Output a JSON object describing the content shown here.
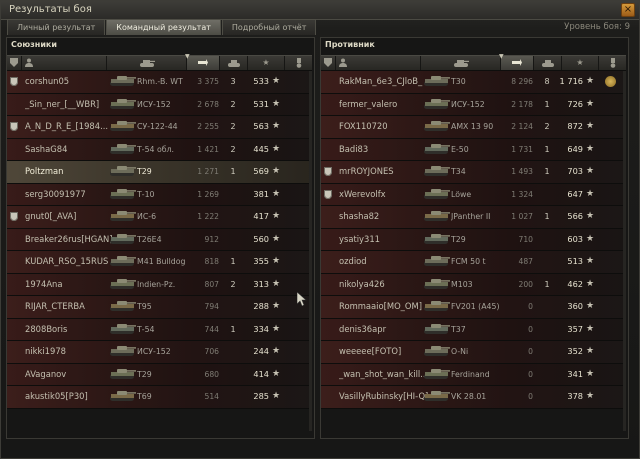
{
  "window": {
    "title": "Результаты боя",
    "close_glyph": "×"
  },
  "tabs": [
    {
      "label": "Личный результат",
      "active": false
    },
    {
      "label": "Командный результат",
      "active": true
    },
    {
      "label": "Подробный отчёт",
      "active": false
    }
  ],
  "battle_level": "Уровень боя: 9",
  "columns": {
    "platoon_icon": "platoon-icon",
    "player_icon": "player-icon",
    "vehicle_icon": "tank-icon",
    "damage_icon": "damage-icon",
    "kills_icon": "destroyed-tank-icon",
    "xp_icon": "experience-star-icon",
    "medal_icon": "achievement-icon",
    "sort_arrow": "▼"
  },
  "allies": {
    "title": "Союзники",
    "rows": [
      {
        "player": "corshun05",
        "platoon": true,
        "vehicle": "Rhm.-B. WT",
        "damage": "3 375",
        "kills": "3",
        "xp": "533"
      },
      {
        "player": "_Sin_ner_[__WBR]",
        "platoon": false,
        "vehicle": "ИСУ-152",
        "damage": "2 678",
        "kills": "2",
        "xp": "531"
      },
      {
        "player": "A_N_D_R_E_[1984...",
        "platoon": true,
        "vehicle": "СУ-122-44",
        "damage": "2 255",
        "kills": "2",
        "xp": "563"
      },
      {
        "player": "SashaG84",
        "platoon": false,
        "vehicle": "Т-54 обл.",
        "damage": "1 421",
        "kills": "2",
        "xp": "445"
      },
      {
        "player": "Poltzman",
        "platoon": false,
        "vehicle": "T29",
        "damage": "1 271",
        "kills": "1",
        "xp": "569",
        "self": true
      },
      {
        "player": "serg30091977",
        "platoon": false,
        "vehicle": "Т-10",
        "damage": "1 269",
        "kills": "",
        "xp": "381"
      },
      {
        "player": "gnut0[_AVA]",
        "platoon": true,
        "vehicle": "ИС-6",
        "damage": "1 222",
        "kills": "",
        "xp": "417"
      },
      {
        "player": "Breaker26rus[HGAN]",
        "platoon": false,
        "vehicle": "T26E4",
        "damage": "912",
        "kills": "",
        "xp": "560"
      },
      {
        "player": "KUDAR_RSO_15RUS",
        "platoon": false,
        "vehicle": "M41 Bulldog",
        "damage": "818",
        "kills": "1",
        "xp": "355"
      },
      {
        "player": "1974Ana",
        "platoon": false,
        "vehicle": "Indien-Pz.",
        "damage": "807",
        "kills": "2",
        "xp": "313"
      },
      {
        "player": "RIJAR_CTERBA",
        "platoon": false,
        "vehicle": "T95",
        "damage": "794",
        "kills": "",
        "xp": "288"
      },
      {
        "player": "2808Boris",
        "platoon": false,
        "vehicle": "Т-54",
        "damage": "744",
        "kills": "1",
        "xp": "334"
      },
      {
        "player": "nikki1978",
        "platoon": false,
        "vehicle": "ИСУ-152",
        "damage": "706",
        "kills": "",
        "xp": "244"
      },
      {
        "player": "AVaganov",
        "platoon": false,
        "vehicle": "T29",
        "damage": "680",
        "kills": "",
        "xp": "414"
      },
      {
        "player": "akustik05[P30]",
        "platoon": false,
        "vehicle": "T69",
        "damage": "514",
        "kills": "",
        "xp": "285"
      }
    ]
  },
  "enemies": {
    "title": "Противник",
    "rows": [
      {
        "player": "RakMan_6e3_CJloB_",
        "platoon": false,
        "vehicle": "T30",
        "damage": "8 296",
        "kills": "8",
        "xp": "1 716",
        "medal": true
      },
      {
        "player": "fermer_valero",
        "platoon": false,
        "vehicle": "ИСУ-152",
        "damage": "2 178",
        "kills": "1",
        "xp": "726"
      },
      {
        "player": "FOX110720",
        "platoon": false,
        "vehicle": "AMX 13 90",
        "damage": "2 124",
        "kills": "2",
        "xp": "872"
      },
      {
        "player": "Badi83",
        "platoon": false,
        "vehicle": "E-50",
        "damage": "1 731",
        "kills": "1",
        "xp": "649"
      },
      {
        "player": "mrROYJONES",
        "platoon": true,
        "vehicle": "T34",
        "damage": "1 493",
        "kills": "1",
        "xp": "703"
      },
      {
        "player": "xWerevolfx",
        "platoon": true,
        "vehicle": "Löwe",
        "damage": "1 324",
        "kills": "",
        "xp": "647"
      },
      {
        "player": "shasha82",
        "platoon": false,
        "vehicle": "JPanther II",
        "damage": "1 027",
        "kills": "1",
        "xp": "566"
      },
      {
        "player": "ysatiy311",
        "platoon": false,
        "vehicle": "T29",
        "damage": "710",
        "kills": "",
        "xp": "603"
      },
      {
        "player": "ozdiod",
        "platoon": false,
        "vehicle": "FCM 50 t",
        "damage": "487",
        "kills": "",
        "xp": "513"
      },
      {
        "player": "nikolya426",
        "platoon": false,
        "vehicle": "M103",
        "damage": "200",
        "kills": "1",
        "xp": "462"
      },
      {
        "player": "Rommaaio[MO_OM]",
        "platoon": false,
        "vehicle": "FV201 (A45)",
        "damage": "0",
        "kills": "",
        "xp": "360"
      },
      {
        "player": "denis36apr",
        "platoon": false,
        "vehicle": "T37",
        "damage": "0",
        "kills": "",
        "xp": "357"
      },
      {
        "player": "weeeee[FOTO]",
        "platoon": false,
        "vehicle": "O-Ni",
        "damage": "0",
        "kills": "",
        "xp": "352"
      },
      {
        "player": "_wan_shot_wan_kill...",
        "platoon": false,
        "vehicle": "Ferdinand",
        "damage": "0",
        "kills": "",
        "xp": "341"
      },
      {
        "player": "VasillyRubinsky[HI-Q]",
        "platoon": false,
        "vehicle": "VK 28.01",
        "damage": "0",
        "kills": "",
        "xp": "378"
      }
    ]
  },
  "colors": {
    "accent_orange": "#d59a3a",
    "enemy_row": "#3c1e1b",
    "self_row": "#4f4739"
  },
  "star_glyph": "★"
}
